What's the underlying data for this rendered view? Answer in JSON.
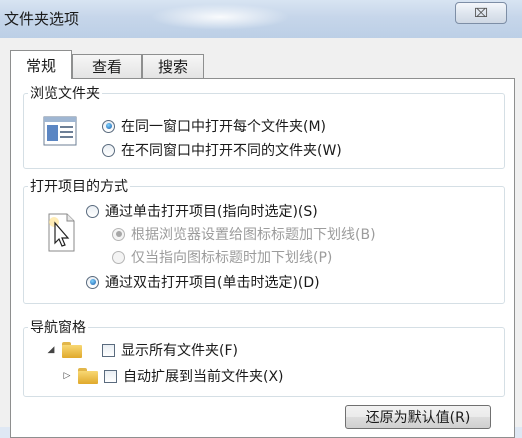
{
  "window": {
    "title": "文件夹选项",
    "close_glyph": "⌧"
  },
  "tabs": [
    {
      "label": "常规",
      "active": true
    },
    {
      "label": "查看",
      "active": false
    },
    {
      "label": "搜索",
      "active": false
    }
  ],
  "browse_folders": {
    "title": "浏览文件夹",
    "options": [
      {
        "label": "在同一窗口中打开每个文件夹(M)",
        "checked": true
      },
      {
        "label": "在不同窗口中打开不同的文件夹(W)",
        "checked": false
      }
    ]
  },
  "open_items": {
    "title": "打开项目的方式",
    "single_click": {
      "label": "通过单击打开项目(指向时选定)(S)",
      "checked": false
    },
    "sub_options": [
      {
        "label": "根据浏览器设置给图标标题加下划线(B)",
        "checked": true,
        "disabled": true
      },
      {
        "label": "仅当指向图标标题时加下划线(P)",
        "checked": false,
        "disabled": true
      }
    ],
    "double_click": {
      "label": "通过双击打开项目(单击时选定)(D)",
      "checked": true
    }
  },
  "navigation_pane": {
    "title": "导航窗格",
    "items": [
      {
        "label": "显示所有文件夹(F)",
        "checked": false,
        "arrow": "◢"
      },
      {
        "label": "自动扩展到当前文件夹(X)",
        "checked": false,
        "arrow": "▷"
      }
    ]
  },
  "buttons": {
    "restore_defaults": "还原为默认值(R)"
  }
}
